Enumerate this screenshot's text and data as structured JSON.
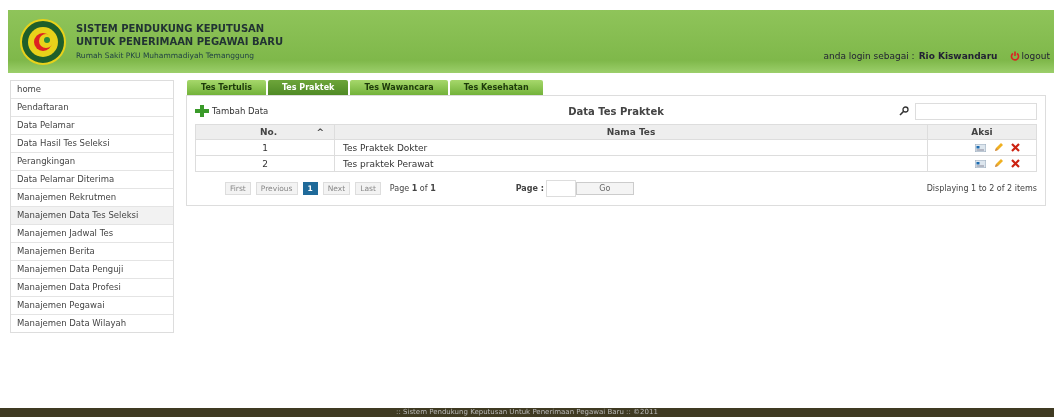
{
  "header": {
    "title_line_1": "SISTEM PENDUKUNG KEPUTUSAN",
    "title_line_2": "UNTUK PENERIMAAN PEGAWAI BARU",
    "subtitle": "Rumah Sakit PKU Muhammadiyah Temanggung",
    "login_label": "anda login sebagai :",
    "user_name": "Rio Kiswandaru",
    "logout": "logout"
  },
  "sidebar": {
    "items": [
      {
        "label": "home",
        "selected": false
      },
      {
        "label": "Pendaftaran",
        "selected": false
      },
      {
        "label": "Data Pelamar",
        "selected": false
      },
      {
        "label": "Data Hasil Tes Seleksi",
        "selected": false
      },
      {
        "label": "Perangkingan",
        "selected": false
      },
      {
        "label": "Data Pelamar Diterima",
        "selected": false
      },
      {
        "label": "Manajemen Rekrutmen",
        "selected": false
      },
      {
        "label": "Manajemen Data Tes Seleksi",
        "selected": true
      },
      {
        "label": "Manajemen Jadwal Tes",
        "selected": false
      },
      {
        "label": "Manajemen Berita",
        "selected": false
      },
      {
        "label": "Manajemen Data Penguji",
        "selected": false
      },
      {
        "label": "Manajemen Data Profesi",
        "selected": false
      },
      {
        "label": "Manajemen Pegawai",
        "selected": false
      },
      {
        "label": "Manajemen Data Wilayah",
        "selected": false
      }
    ]
  },
  "tabs": [
    {
      "label": "Tes Tertulis",
      "selected": false
    },
    {
      "label": "Tes Praktek",
      "selected": true
    },
    {
      "label": "Tes Wawancara",
      "selected": false
    },
    {
      "label": "Tes Kesehatan",
      "selected": false
    }
  ],
  "grid": {
    "add_button": "Tambah Data",
    "title": "Data Tes Praktek",
    "columns": [
      {
        "label": "No.",
        "sort_icon": "^"
      },
      {
        "label": "Nama Tes"
      },
      {
        "label": "Aksi"
      }
    ],
    "rows": [
      {
        "no": "1",
        "name": "Tes Praktek Dokter"
      },
      {
        "no": "2",
        "name": "Tes praktek Perawat"
      }
    ],
    "pager": {
      "buttons": [
        {
          "label": "First",
          "disabled": true
        },
        {
          "label": "Previous",
          "disabled": true
        },
        {
          "label": "1",
          "selected": true
        },
        {
          "label": "Next",
          "disabled": true
        },
        {
          "label": "Last",
          "disabled": true
        }
      ],
      "page_text": "Page **1** of **1**",
      "page_label": "Page :",
      "go": "Go",
      "info": "Displaying 1 to 2 of 2 items"
    }
  },
  "footer": ":: Sistem Pendukung Keputusan Untuk Penerimaan Pegawai Baru :: ©2011"
}
